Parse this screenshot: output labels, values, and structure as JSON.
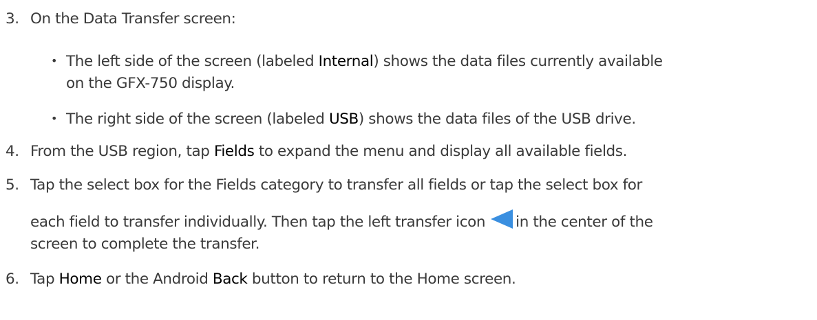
{
  "step3": {
    "num": "3.",
    "text": "On the Data Transfer screen:"
  },
  "bullets": [
    {
      "line1_before": "The left side of the screen (labeled ",
      "line1_bold": "Internal",
      "line1_after": ") shows the data files currently available",
      "line2": "on the GFX-750 display."
    },
    {
      "before": "The right side of the screen (labeled ",
      "bold": "USB",
      "after": ") shows the data files of the USB drive."
    }
  ],
  "step4": {
    "num": "4.",
    "before": "From the USB region, tap ",
    "bold": "Fields",
    "after": " to expand the menu and display all available fields."
  },
  "step5": {
    "num": "5.",
    "line1": "Tap the select box for the Fields category to transfer all fields or tap the select box for",
    "line2_before": "each field to transfer individually. Then tap the left transfer icon",
    "line2_after": "in the center of the",
    "line3": "screen to complete the transfer."
  },
  "step6": {
    "num": "6.",
    "part1": "Tap ",
    "bold1": "Home",
    "part2": " or the Android ",
    "bold2": "Back",
    "part3": " button to return to the Home screen."
  },
  "icon": {
    "name": "left-transfer-arrow-icon",
    "color": "#3a8fe0"
  }
}
